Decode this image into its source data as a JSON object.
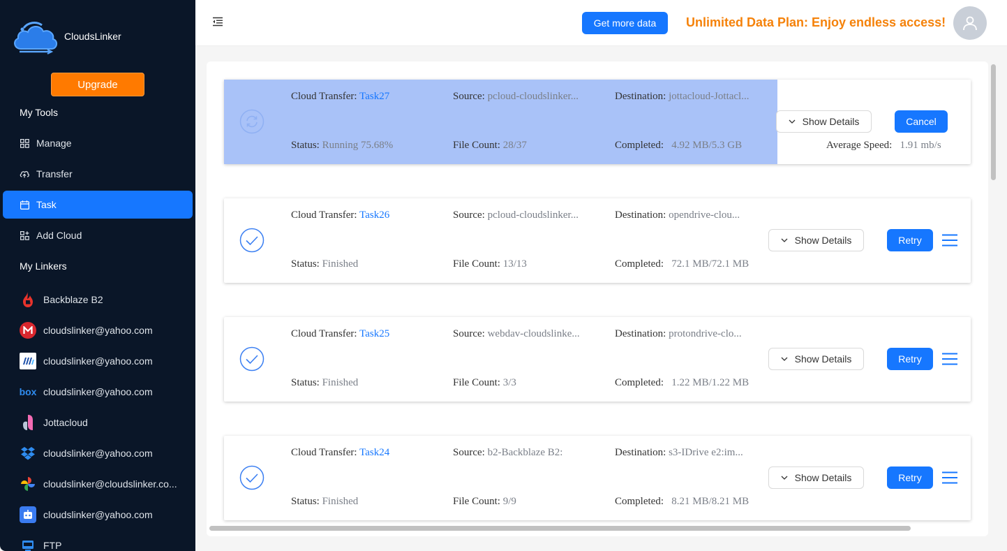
{
  "app": {
    "brand": "CloudsLinker",
    "upgrade_label": "Upgrade"
  },
  "sidebar": {
    "my_tools_title": "My Tools",
    "tools": [
      {
        "label": "Manage",
        "icon": "grid-icon"
      },
      {
        "label": "Transfer",
        "icon": "cloud-upload-icon"
      },
      {
        "label": "Task",
        "icon": "calendar-icon",
        "active": true
      },
      {
        "label": "Add Cloud",
        "icon": "add-grid-icon"
      }
    ],
    "my_linkers_title": "My Linkers",
    "linkers": [
      {
        "label": "Backblaze B2",
        "icon": "backblaze-icon"
      },
      {
        "label": "cloudslinker@yahoo.com",
        "icon": "mega-icon"
      },
      {
        "label": "cloudslinker@yahoo.com",
        "icon": "idrive-icon"
      },
      {
        "label": "cloudslinker@yahoo.com",
        "icon": "box-icon"
      },
      {
        "label": "Jottacloud",
        "icon": "jottacloud-icon"
      },
      {
        "label": "cloudslinker@yahoo.com",
        "icon": "dropbox-icon"
      },
      {
        "label": "cloudslinker@cloudslinker.co...",
        "icon": "google-photos-icon"
      },
      {
        "label": "cloudslinker@yahoo.com",
        "icon": "robot-icon"
      },
      {
        "label": "FTP",
        "icon": "ftp-icon"
      }
    ]
  },
  "header": {
    "get_more_label": "Get more data",
    "promo": "Unlimited Data Plan: Enjoy endless access!"
  },
  "labels": {
    "cloud_transfer": "Cloud Transfer:",
    "source": "Source:",
    "destination": "Destination:",
    "status": "Status:",
    "file_count": "File Count:",
    "completed": "Completed:",
    "average_speed": "Average Speed:",
    "show_details": "Show Details",
    "cancel": "Cancel",
    "retry": "Retry"
  },
  "tasks": [
    {
      "name": "Task27",
      "source": "pcloud-cloudslinker...",
      "destination": "jottacloud-Jottacl...",
      "status": "Running 75.68%",
      "file_count": "28/37",
      "completed": "4.92 MB/5.3 GB",
      "average_speed": "1.91 mb/s",
      "progress": 0.7568
    },
    {
      "name": "Task26",
      "source": "pcloud-cloudslinker...",
      "destination": "opendrive-clou...",
      "status": "Finished",
      "file_count": "13/13",
      "completed": "72.1 MB/72.1 MB"
    },
    {
      "name": "Task25",
      "source": "webdav-cloudslinke...",
      "destination": "protondrive-clo...",
      "status": "Finished",
      "file_count": "3/3",
      "completed": "1.22 MB/1.22 MB"
    },
    {
      "name": "Task24",
      "source": "b2-Backblaze B2:",
      "destination": "s3-IDrive e2:im...",
      "status": "Finished",
      "file_count": "9/9",
      "completed": "8.21 MB/8.21 MB"
    }
  ],
  "colors": {
    "sidebar_bg": "#0a1628",
    "accent": "#1677ff",
    "promo": "#f5820a",
    "running_highlight": "#a9c2f8"
  }
}
